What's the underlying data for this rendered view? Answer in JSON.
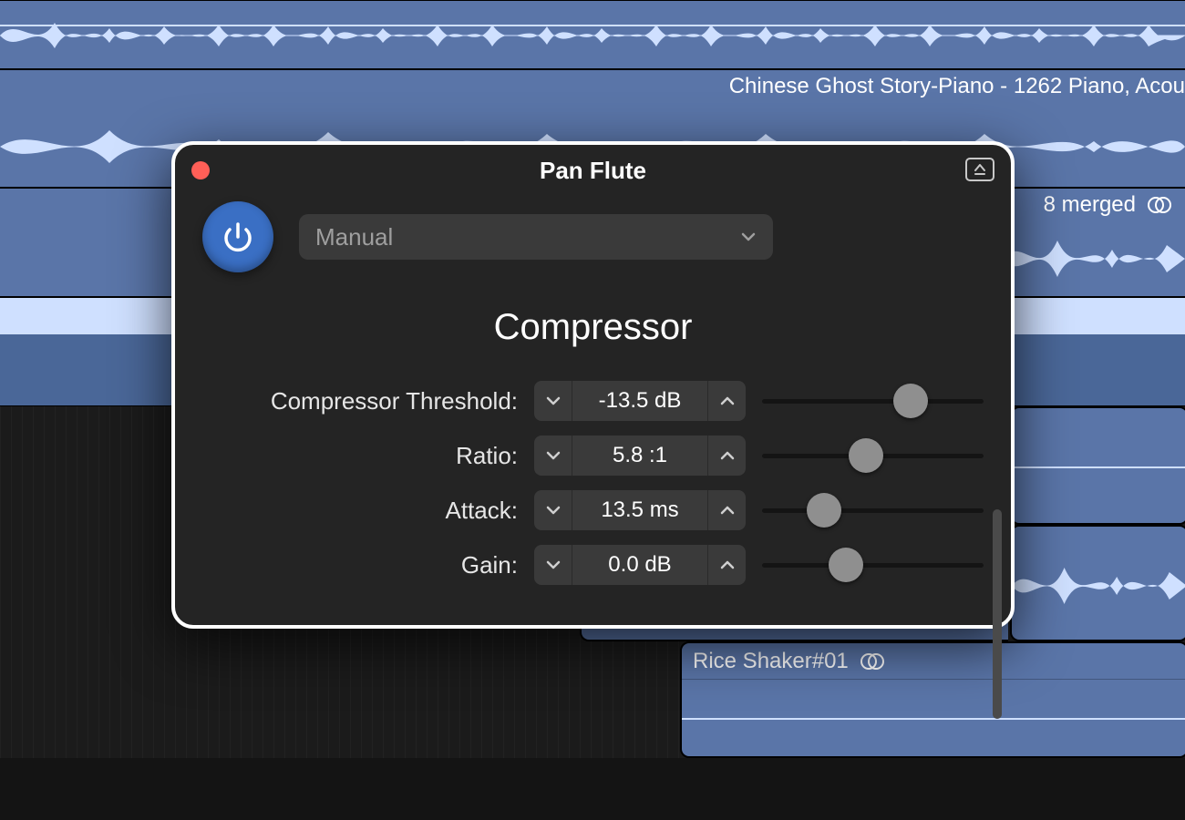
{
  "colors": {
    "track_bg": "#5a75a8",
    "panel_bg": "#242424",
    "accent": "#3a6fc4"
  },
  "tracks": {
    "t1": {
      "label": "Chinese Ghost Story-Piano - 1262 Piano, Acou"
    },
    "t2": {
      "label": "8 merged"
    },
    "clip1": {
      "label": "Rice Shaker#01"
    }
  },
  "panel": {
    "title": "Pan Flute",
    "preset": "Manual",
    "effect_title": "Compressor",
    "params": {
      "threshold": {
        "label": "Compressor Threshold:",
        "value": "-13.5 dB",
        "slider_pct": 67
      },
      "ratio": {
        "label": "Ratio:",
        "value": "5.8 :1",
        "slider_pct": 47
      },
      "attack": {
        "label": "Attack:",
        "value": "13.5 ms",
        "slider_pct": 28
      },
      "gain": {
        "label": "Gain:",
        "value": "0.0 dB",
        "slider_pct": 38
      }
    }
  }
}
